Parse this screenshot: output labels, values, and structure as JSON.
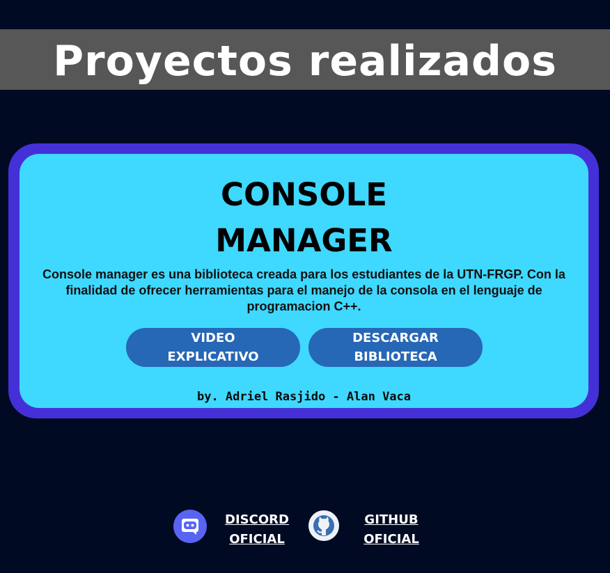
{
  "header": {
    "title": "Proyectos realizados"
  },
  "project": {
    "title_line1": "CONSOLE",
    "title_line2": "MANAGER",
    "description": "Console manager es una biblioteca creada para los estudiantes de la UTN-FRGP. Con la finalidad de ofrecer herramientas para el manejo de la consola en el lenguaje de programacion C++.",
    "video_button_line1": "VIDEO",
    "video_button_line2": "EXPLICATIVO",
    "download_button_line1": "DESCARGAR",
    "download_button_line2": "BIBLIOTECA",
    "authors": "by. Adriel Rasjido - Alan Vaca"
  },
  "footer": {
    "discord_line1": "DISCORD",
    "discord_line2": "OFICIAL",
    "github_line1": "GITHUB",
    "github_line2": "OFICIAL",
    "discord_icon": "discord-icon",
    "github_icon": "github-icon"
  },
  "colors": {
    "background": "#000a22",
    "header_bar": "#575757",
    "card_border": "#4530d8",
    "card_fill": "#3fd8ff",
    "button": "#2667b6"
  }
}
